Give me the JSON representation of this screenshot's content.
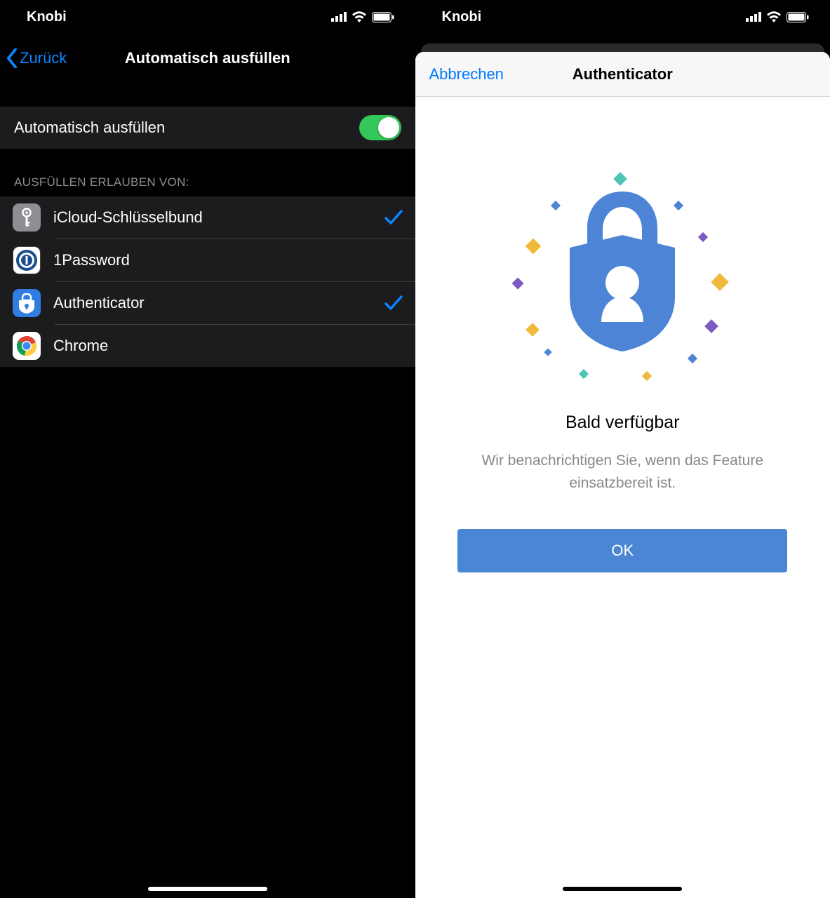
{
  "status": {
    "carrier": "Knobi"
  },
  "left": {
    "nav": {
      "back": "Zurück",
      "title": "Automatisch ausfüllen"
    },
    "toggle_row": {
      "label": "Automatisch ausfüllen"
    },
    "section_header": "AUSFÜLLEN ERLAUBEN VON:",
    "providers": [
      {
        "label": "iCloud-Schlüsselbund",
        "checked": true
      },
      {
        "label": "1Password",
        "checked": false
      },
      {
        "label": "Authenticator",
        "checked": true
      },
      {
        "label": "Chrome",
        "checked": false
      }
    ]
  },
  "right": {
    "modal": {
      "cancel": "Abbrechen",
      "title": "Authenticator",
      "soon_title": "Bald verfügbar",
      "soon_desc": "Wir benachrichtigen Sie, wenn das Feature einsatzbereit ist.",
      "ok": "OK"
    }
  }
}
